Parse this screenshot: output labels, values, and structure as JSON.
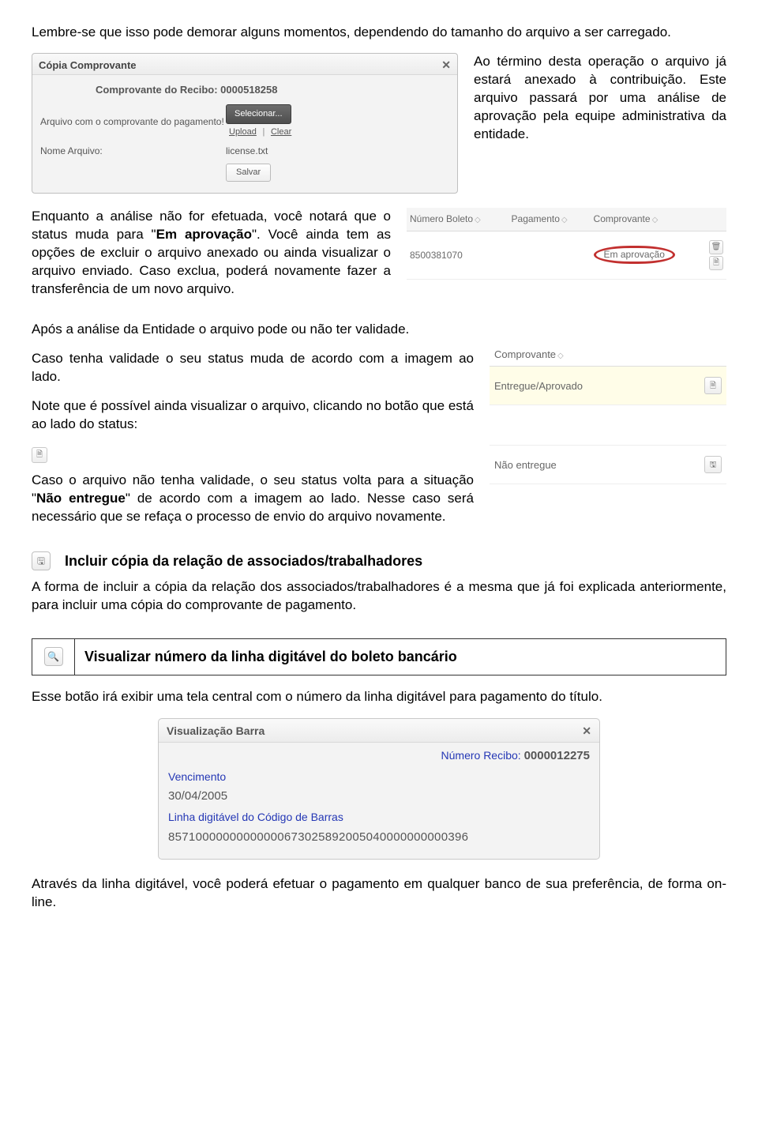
{
  "intro_note": "Lembre-se que isso pode demorar alguns momentos, dependendo do tamanho do arquivo a ser carregado.",
  "dialog_upload": {
    "title": "Cópia Comprovante",
    "close": "✕",
    "recibo_label": "Comprovante do Recibo: 0000518258",
    "field1_label": "Arquivo com o comprovante do pagamento!",
    "selecionar": "Selecionar...",
    "upload": "Upload",
    "clear": "Clear",
    "nome_label": "Nome Arquivo:",
    "nome_value": "license.txt",
    "salvar": "Salvar"
  },
  "aside_top": "Ao término desta operação o arquivo já estará anexado à contribuição. Este arquivo passará por uma análise de aprovação pela equipe administrativa da entidade.",
  "status_para_a": "Enquanto a análise não for efetuada, você notará que o status muda para \"",
  "status_bold": "Em aprovação",
  "status_para_b": "\". Você ainda tem as opções de excluir o arquivo anexado ou ainda visualizar o arquivo enviado. Caso exclua, poderá novamente fazer a transferência de um novo arquivo.",
  "mini_table": {
    "h1": "Número Boleto",
    "h2": "Pagamento",
    "h3": "Comprovante",
    "row_boleto": "8500381070",
    "row_status": "Em aprovação"
  },
  "p_apos": "Após a análise da Entidade o arquivo pode ou não ter validade.",
  "p_caso_validade": "Caso tenha validade o seu status muda de acordo com a imagem ao lado.",
  "p_note": "Note que é possível ainda visualizar o arquivo, clicando no botão que está ao lado do status:",
  "p_caso_nao_a": "Caso o arquivo não tenha validade, o seu status volta para a situação \"",
  "p_caso_nao_bold": "Não entregue",
  "p_caso_nao_b": "\" de acordo com a imagem ao lado. Nesse caso será necessário que se refaça o processo de envio do arquivo novamente.",
  "tbl_comprovante": {
    "head": "Comprovante",
    "status_ok": "Entregue/Aprovado",
    "status_no": "Não entregue"
  },
  "section_associados": "Incluir cópia da relação de associados/trabalhadores",
  "p_associados": "A forma de incluir a cópia da relação dos associados/trabalhadores é a mesma que já foi explicada anteriormente, para incluir uma cópia do comprovante de pagamento.",
  "section_barra": "Visualizar número da linha digitável do boleto bancário",
  "p_barra_intro": "Esse botão irá exibir uma tela central com o número da linha digitável para pagamento do título.",
  "dialog_barra": {
    "title": "Visualização Barra",
    "close": "✕",
    "num_label": "Número Recibo:",
    "num_value": "0000012275",
    "venc_label": "Vencimento",
    "venc_value": "30/04/2005",
    "linha_label": "Linha digitável do Código de Barras",
    "linha_value": "85710000000000000673025892005040000000000396"
  },
  "p_final": "Através da linha digitável, você poderá efetuar o pagamento em qualquer banco de sua preferência, de forma on-line.",
  "icons": {
    "view": "🗎",
    "delete": "🗑",
    "save": "🖫",
    "search": "🔍"
  }
}
